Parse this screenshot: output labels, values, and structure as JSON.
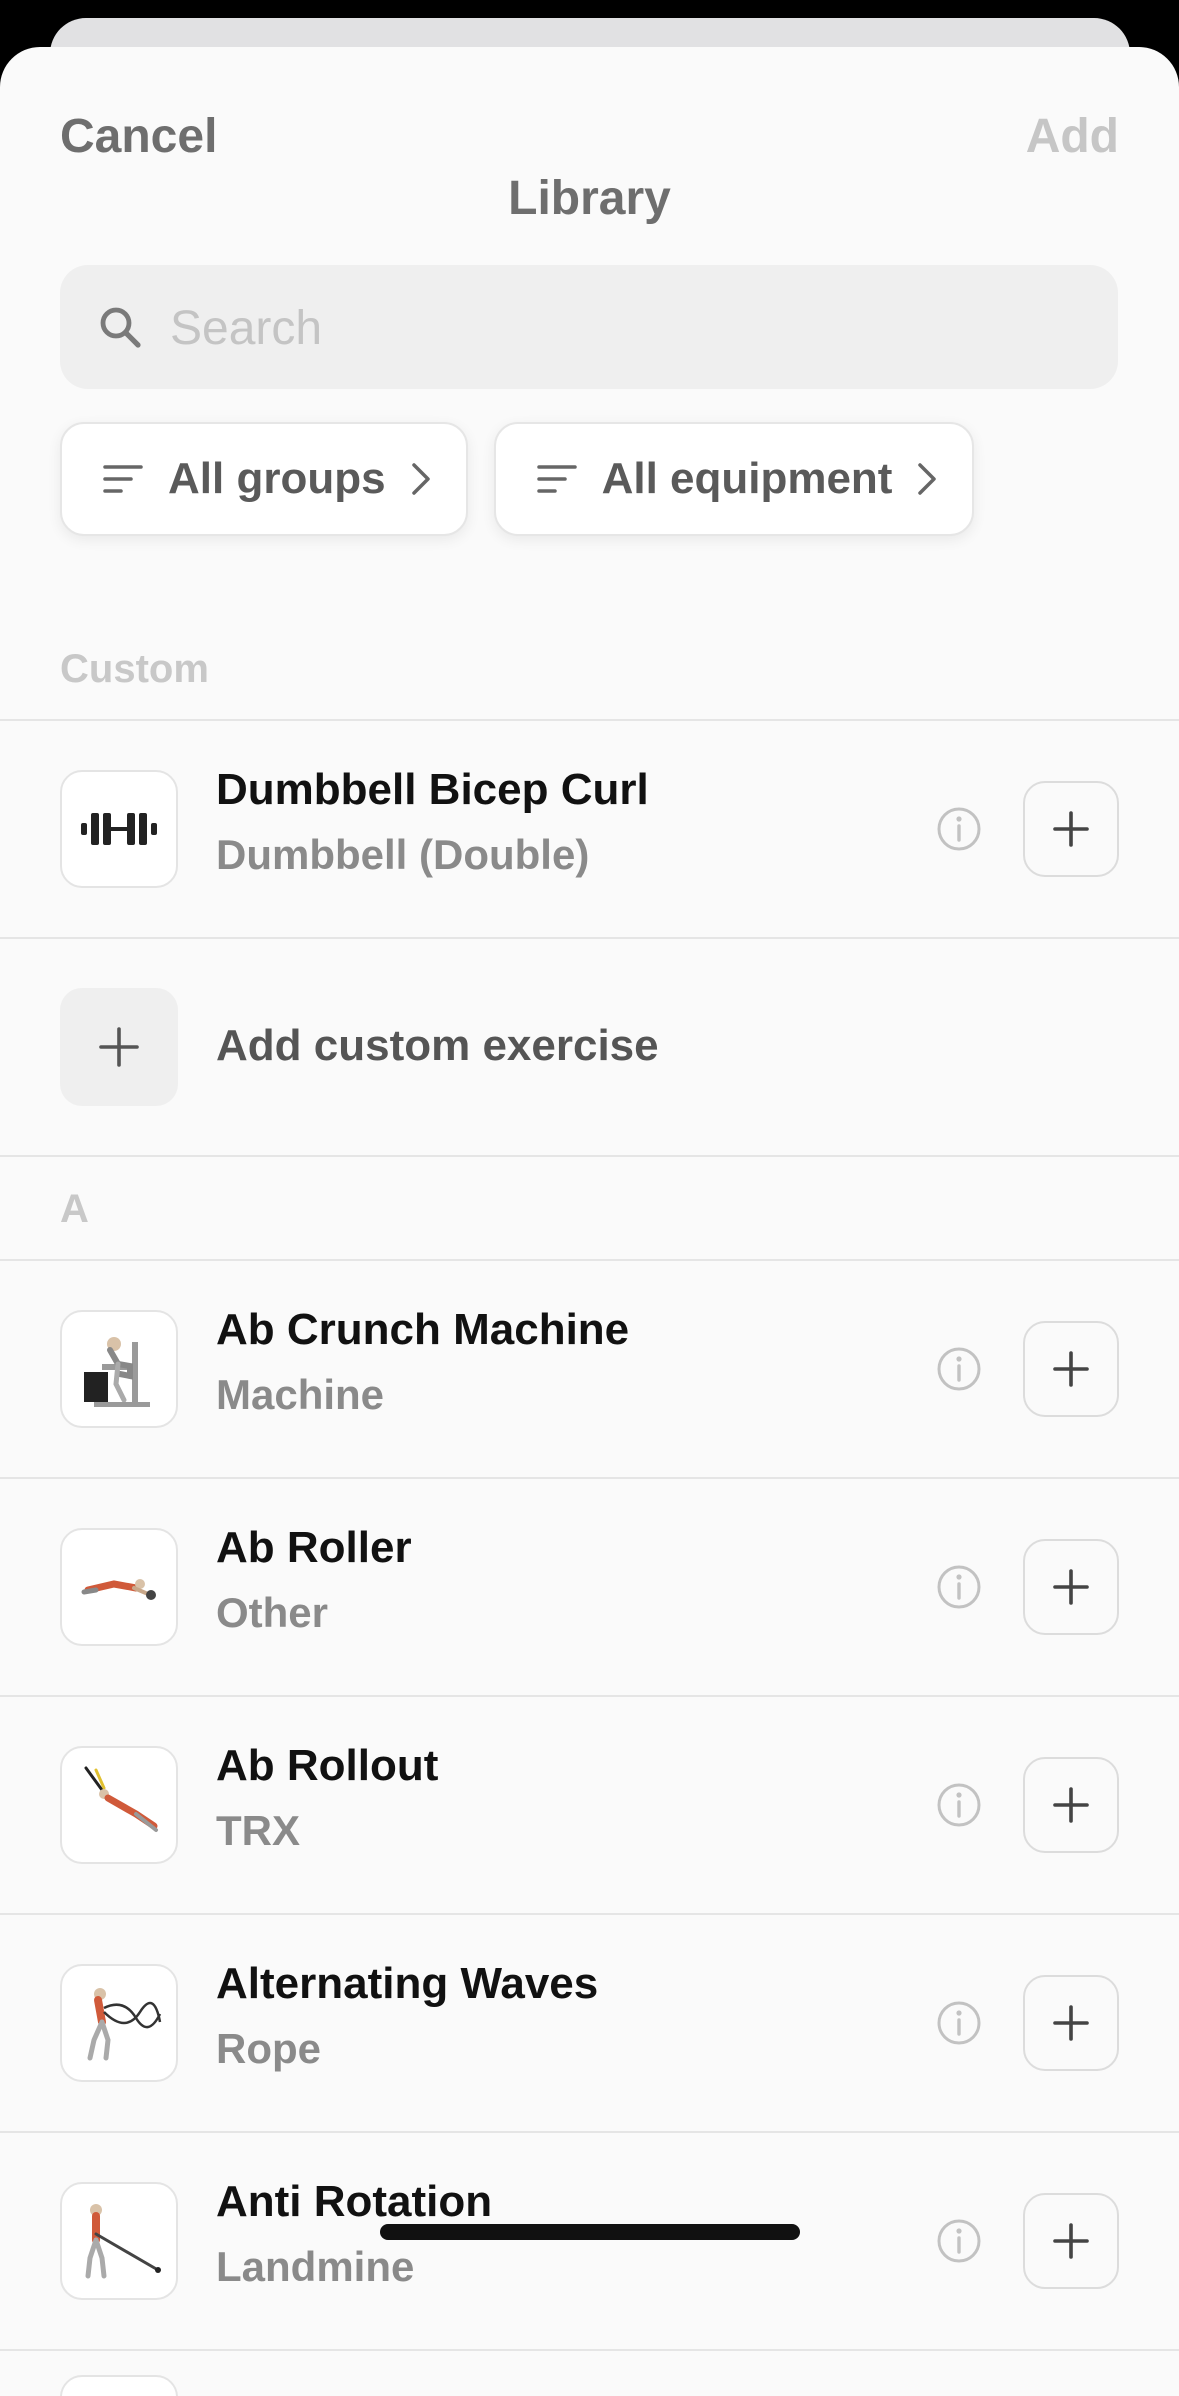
{
  "header": {
    "cancel_label": "Cancel",
    "add_label": "Add",
    "title": "Library"
  },
  "search": {
    "placeholder": "Search"
  },
  "filters": [
    {
      "label": "All groups",
      "icon": "filter-lines-icon"
    },
    {
      "label": "All equipment",
      "icon": "filter-lines-icon"
    }
  ],
  "sections": {
    "custom": {
      "label": "Custom",
      "items": [
        {
          "name": "Dumbbell Bicep Curl",
          "equipment": "Dumbbell (Double)",
          "icon": "dumbbell-icon"
        }
      ],
      "add_custom_label": "Add custom exercise"
    },
    "a": {
      "label": "A",
      "items": [
        {
          "name": "Ab Crunch Machine",
          "equipment": "Machine"
        },
        {
          "name": "Ab Roller",
          "equipment": "Other"
        },
        {
          "name": "Ab Rollout",
          "equipment": "TRX"
        },
        {
          "name": "Alternating Waves",
          "equipment": "Rope"
        },
        {
          "name": "Anti Rotation",
          "equipment": "Landmine"
        }
      ]
    }
  },
  "colors": {
    "primary_text": "#111111",
    "secondary_text": "#8a8a8a",
    "muted": "#c6c6c6",
    "background": "#fafafa"
  }
}
